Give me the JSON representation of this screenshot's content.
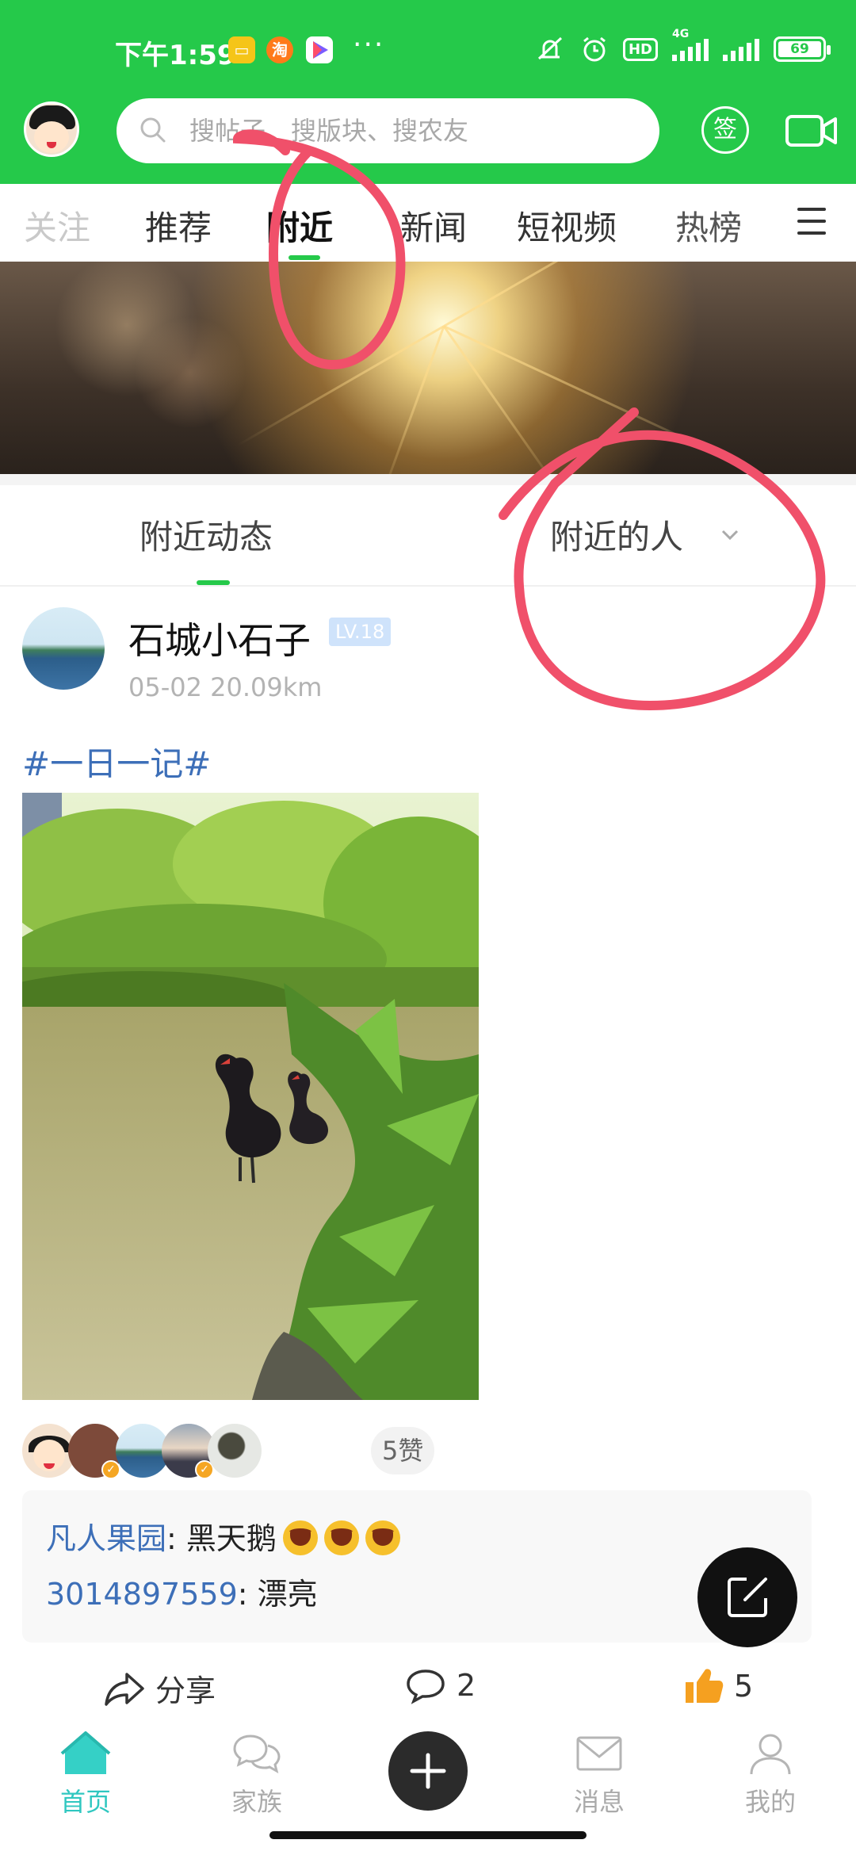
{
  "status_bar": {
    "time": "下午1:59",
    "more": "···",
    "network": "4G",
    "hd": "HD",
    "battery": "69",
    "app_icons": [
      "message-icon",
      "taobao-icon",
      "play-icon"
    ]
  },
  "header": {
    "search_placeholder": "搜帖子、搜版块、搜农友",
    "sign_label": "签",
    "icons": [
      "avatar",
      "search-icon",
      "video-camera-icon"
    ]
  },
  "tabs": [
    {
      "label": "关注"
    },
    {
      "label": "推荐"
    },
    {
      "label": "附近"
    },
    {
      "label": "新闻"
    },
    {
      "label": "短视频"
    },
    {
      "label": "热榜"
    }
  ],
  "active_tab": "附近",
  "subtabs": {
    "nearby_posts": "附近动态",
    "nearby_people": "附近的人"
  },
  "post": {
    "username": "石城小石子",
    "level": "LV.18",
    "meta": "05-02 20.09km",
    "topic": "#一日一记#",
    "likes_pill": "5赞",
    "comments": [
      {
        "user": "凡人果园",
        "sep": ": ",
        "text": "黑天鹅"
      },
      {
        "user": "3014897559",
        "sep": ": ",
        "text": "漂亮"
      }
    ],
    "actions": {
      "share": "分享",
      "comment_count": "2",
      "like_count": "5"
    }
  },
  "bottom_nav": [
    {
      "label": "首页",
      "icon": "home-icon"
    },
    {
      "label": "家族",
      "icon": "chat-bubbles-icon"
    },
    {
      "label": "消息",
      "icon": "mail-icon"
    },
    {
      "label": "我的",
      "icon": "user-icon"
    }
  ],
  "colors": {
    "brand_green": "#25c94a",
    "link_blue": "#3d6fb8",
    "nav_active": "#2fc7c0",
    "annotation_red": "#f0506a"
  }
}
